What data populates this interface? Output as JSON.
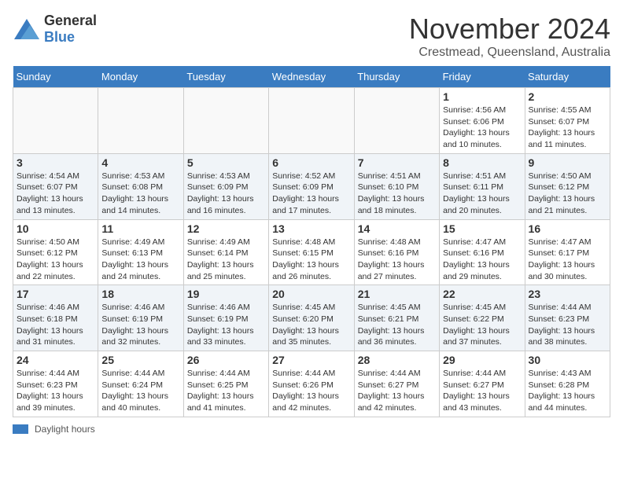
{
  "header": {
    "logo_general": "General",
    "logo_blue": "Blue",
    "month": "November 2024",
    "location": "Crestmead, Queensland, Australia"
  },
  "days_of_week": [
    "Sunday",
    "Monday",
    "Tuesday",
    "Wednesday",
    "Thursday",
    "Friday",
    "Saturday"
  ],
  "weeks": [
    [
      {
        "day": "",
        "empty": true
      },
      {
        "day": "",
        "empty": true
      },
      {
        "day": "",
        "empty": true
      },
      {
        "day": "",
        "empty": true
      },
      {
        "day": "",
        "empty": true
      },
      {
        "day": "1",
        "sunrise": "Sunrise: 4:56 AM",
        "sunset": "Sunset: 6:06 PM",
        "daylight": "Daylight: 13 hours and 10 minutes."
      },
      {
        "day": "2",
        "sunrise": "Sunrise: 4:55 AM",
        "sunset": "Sunset: 6:07 PM",
        "daylight": "Daylight: 13 hours and 11 minutes."
      }
    ],
    [
      {
        "day": "3",
        "sunrise": "Sunrise: 4:54 AM",
        "sunset": "Sunset: 6:07 PM",
        "daylight": "Daylight: 13 hours and 13 minutes."
      },
      {
        "day": "4",
        "sunrise": "Sunrise: 4:53 AM",
        "sunset": "Sunset: 6:08 PM",
        "daylight": "Daylight: 13 hours and 14 minutes."
      },
      {
        "day": "5",
        "sunrise": "Sunrise: 4:53 AM",
        "sunset": "Sunset: 6:09 PM",
        "daylight": "Daylight: 13 hours and 16 minutes."
      },
      {
        "day": "6",
        "sunrise": "Sunrise: 4:52 AM",
        "sunset": "Sunset: 6:09 PM",
        "daylight": "Daylight: 13 hours and 17 minutes."
      },
      {
        "day": "7",
        "sunrise": "Sunrise: 4:51 AM",
        "sunset": "Sunset: 6:10 PM",
        "daylight": "Daylight: 13 hours and 18 minutes."
      },
      {
        "day": "8",
        "sunrise": "Sunrise: 4:51 AM",
        "sunset": "Sunset: 6:11 PM",
        "daylight": "Daylight: 13 hours and 20 minutes."
      },
      {
        "day": "9",
        "sunrise": "Sunrise: 4:50 AM",
        "sunset": "Sunset: 6:12 PM",
        "daylight": "Daylight: 13 hours and 21 minutes."
      }
    ],
    [
      {
        "day": "10",
        "sunrise": "Sunrise: 4:50 AM",
        "sunset": "Sunset: 6:12 PM",
        "daylight": "Daylight: 13 hours and 22 minutes."
      },
      {
        "day": "11",
        "sunrise": "Sunrise: 4:49 AM",
        "sunset": "Sunset: 6:13 PM",
        "daylight": "Daylight: 13 hours and 24 minutes."
      },
      {
        "day": "12",
        "sunrise": "Sunrise: 4:49 AM",
        "sunset": "Sunset: 6:14 PM",
        "daylight": "Daylight: 13 hours and 25 minutes."
      },
      {
        "day": "13",
        "sunrise": "Sunrise: 4:48 AM",
        "sunset": "Sunset: 6:15 PM",
        "daylight": "Daylight: 13 hours and 26 minutes."
      },
      {
        "day": "14",
        "sunrise": "Sunrise: 4:48 AM",
        "sunset": "Sunset: 6:16 PM",
        "daylight": "Daylight: 13 hours and 27 minutes."
      },
      {
        "day": "15",
        "sunrise": "Sunrise: 4:47 AM",
        "sunset": "Sunset: 6:16 PM",
        "daylight": "Daylight: 13 hours and 29 minutes."
      },
      {
        "day": "16",
        "sunrise": "Sunrise: 4:47 AM",
        "sunset": "Sunset: 6:17 PM",
        "daylight": "Daylight: 13 hours and 30 minutes."
      }
    ],
    [
      {
        "day": "17",
        "sunrise": "Sunrise: 4:46 AM",
        "sunset": "Sunset: 6:18 PM",
        "daylight": "Daylight: 13 hours and 31 minutes."
      },
      {
        "day": "18",
        "sunrise": "Sunrise: 4:46 AM",
        "sunset": "Sunset: 6:19 PM",
        "daylight": "Daylight: 13 hours and 32 minutes."
      },
      {
        "day": "19",
        "sunrise": "Sunrise: 4:46 AM",
        "sunset": "Sunset: 6:19 PM",
        "daylight": "Daylight: 13 hours and 33 minutes."
      },
      {
        "day": "20",
        "sunrise": "Sunrise: 4:45 AM",
        "sunset": "Sunset: 6:20 PM",
        "daylight": "Daylight: 13 hours and 35 minutes."
      },
      {
        "day": "21",
        "sunrise": "Sunrise: 4:45 AM",
        "sunset": "Sunset: 6:21 PM",
        "daylight": "Daylight: 13 hours and 36 minutes."
      },
      {
        "day": "22",
        "sunrise": "Sunrise: 4:45 AM",
        "sunset": "Sunset: 6:22 PM",
        "daylight": "Daylight: 13 hours and 37 minutes."
      },
      {
        "day": "23",
        "sunrise": "Sunrise: 4:44 AM",
        "sunset": "Sunset: 6:23 PM",
        "daylight": "Daylight: 13 hours and 38 minutes."
      }
    ],
    [
      {
        "day": "24",
        "sunrise": "Sunrise: 4:44 AM",
        "sunset": "Sunset: 6:23 PM",
        "daylight": "Daylight: 13 hours and 39 minutes."
      },
      {
        "day": "25",
        "sunrise": "Sunrise: 4:44 AM",
        "sunset": "Sunset: 6:24 PM",
        "daylight": "Daylight: 13 hours and 40 minutes."
      },
      {
        "day": "26",
        "sunrise": "Sunrise: 4:44 AM",
        "sunset": "Sunset: 6:25 PM",
        "daylight": "Daylight: 13 hours and 41 minutes."
      },
      {
        "day": "27",
        "sunrise": "Sunrise: 4:44 AM",
        "sunset": "Sunset: 6:26 PM",
        "daylight": "Daylight: 13 hours and 42 minutes."
      },
      {
        "day": "28",
        "sunrise": "Sunrise: 4:44 AM",
        "sunset": "Sunset: 6:27 PM",
        "daylight": "Daylight: 13 hours and 42 minutes."
      },
      {
        "day": "29",
        "sunrise": "Sunrise: 4:44 AM",
        "sunset": "Sunset: 6:27 PM",
        "daylight": "Daylight: 13 hours and 43 minutes."
      },
      {
        "day": "30",
        "sunrise": "Sunrise: 4:43 AM",
        "sunset": "Sunset: 6:28 PM",
        "daylight": "Daylight: 13 hours and 44 minutes."
      }
    ]
  ],
  "legend": {
    "label": "Daylight hours"
  }
}
